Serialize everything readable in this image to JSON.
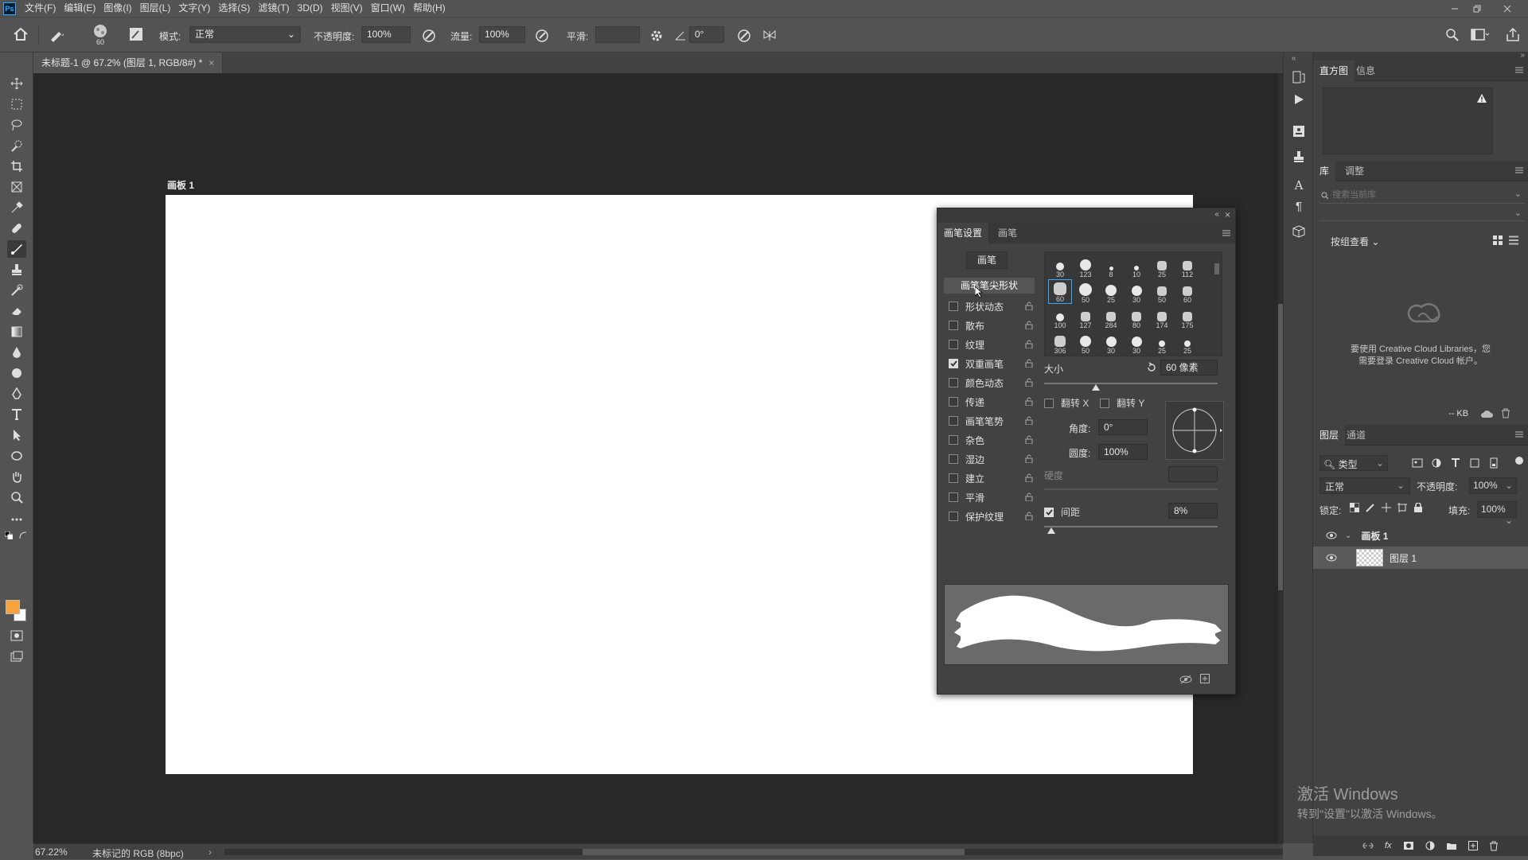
{
  "app": {
    "logo": "Ps"
  },
  "menu": [
    "文件(F)",
    "编辑(E)",
    "图像(I)",
    "图层(L)",
    "文字(Y)",
    "选择(S)",
    "滤镜(T)",
    "3D(D)",
    "视图(V)",
    "窗口(W)",
    "帮助(H)"
  ],
  "options": {
    "brush_size": "60",
    "mode_label": "模式:",
    "mode_value": "正常",
    "opacity_label": "不透明度:",
    "opacity_value": "100%",
    "flow_label": "流量:",
    "flow_value": "100%",
    "smooth_label": "平滑:",
    "smooth_value": "",
    "angle_value": "0°"
  },
  "document": {
    "tab_title": "未标题-1 @ 67.2% (图层 1, RGB/8#) *",
    "artboard_label": "画板 1"
  },
  "brush_panel": {
    "tabs": [
      "画笔设置",
      "画笔"
    ],
    "brush_button": "画笔",
    "tip_shape": "画笔笔尖形状",
    "options": [
      {
        "label": "形状动态",
        "checked": false
      },
      {
        "label": "散布",
        "checked": false
      },
      {
        "label": "纹理",
        "checked": false
      },
      {
        "label": "双重画笔",
        "checked": true
      },
      {
        "label": "颜色动态",
        "checked": false
      },
      {
        "label": "传递",
        "checked": false
      },
      {
        "label": "画笔笔势",
        "checked": false
      },
      {
        "label": "杂色",
        "checked": false
      },
      {
        "label": "湿边",
        "checked": false
      },
      {
        "label": "建立",
        "checked": false
      },
      {
        "label": "平滑",
        "checked": false
      },
      {
        "label": "保护纹理",
        "checked": false
      }
    ],
    "brush_sizes": [
      [
        "30",
        "123",
        "8",
        "10",
        "25",
        "112"
      ],
      [
        "60",
        "50",
        "25",
        "30",
        "50",
        "60"
      ],
      [
        "100",
        "127",
        "284",
        "80",
        "174",
        "175"
      ],
      [
        "306",
        "50",
        "30",
        "30",
        "25",
        "25"
      ]
    ],
    "size_label": "大小",
    "size_value": "60 像素",
    "flip_x": "翻转 X",
    "flip_y": "翻转 Y",
    "angle_label": "角度:",
    "angle_value": "0°",
    "roundness_label": "圆度:",
    "roundness_value": "100%",
    "hardness_label": "硬度",
    "spacing_label": "间距",
    "spacing_value": "8%"
  },
  "right_panels": {
    "hist_tabs": [
      "直方图",
      "信息"
    ],
    "lib_tabs": [
      "库",
      "调整"
    ],
    "lib_search_placeholder": "搜索当前库",
    "view_by": "按组查看",
    "lib_message_1": "要使用 Creative Cloud Libraries，您",
    "lib_message_2": "需要登录 Creative Cloud 帐户。",
    "kb_label": "-- KB",
    "layers_tabs": [
      "图层",
      "通道"
    ],
    "filter_kind": "类型",
    "blend_mode": "正常",
    "opacity_label": "不透明度:",
    "opacity_value": "100%",
    "lock_label": "锁定:",
    "fill_label": "填充:",
    "fill_value": "100%",
    "layers": [
      {
        "name": "画板 1",
        "type": "artboard"
      },
      {
        "name": "图层 1",
        "type": "layer"
      }
    ]
  },
  "status": {
    "zoom": "67.22%",
    "profile": "未标记的 RGB (8bpc)"
  },
  "watermark": {
    "title": "激活 Windows",
    "subtitle": "转到\"设置\"以激活 Windows。"
  },
  "colors": {
    "foreground": "#f7a23b",
    "background": "#ffffff",
    "accent": "#31a8ff"
  }
}
